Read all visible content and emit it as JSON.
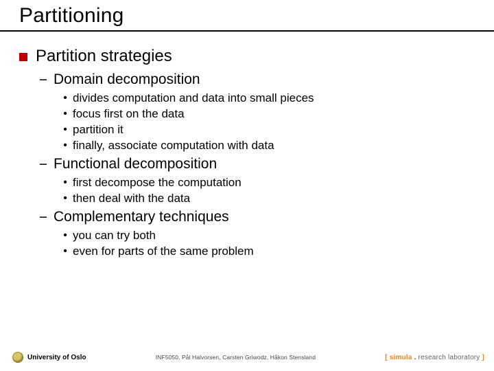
{
  "title": "Partitioning",
  "level1": {
    "text": "Partition strategies"
  },
  "sections": [
    {
      "heading": "Domain decomposition",
      "items": [
        "divides computation and data into small pieces",
        "focus first on the data",
        "partition it",
        "finally, associate computation with data"
      ]
    },
    {
      "heading": "Functional decomposition",
      "items": [
        "first decompose the computation",
        "then deal with the data"
      ]
    },
    {
      "heading": "Complementary techniques",
      "items": [
        "you can try both",
        "even for parts of the same problem"
      ]
    }
  ],
  "footer": {
    "left": "University of Oslo",
    "center": "INF5050, Pål Halvorsen, Carsten Griwodz, Håkon Stensland",
    "right": {
      "open": "[ ",
      "brand": "simula",
      "dot": " . ",
      "rest": "research laboratory",
      "close": " ]"
    }
  }
}
